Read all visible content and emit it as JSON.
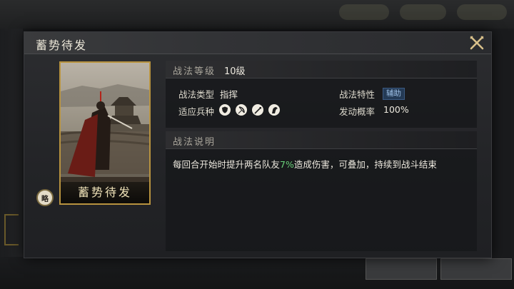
{
  "dialog": {
    "title": "蓄势待发"
  },
  "card": {
    "name": "蓄势待发",
    "badge": "略"
  },
  "skill": {
    "level_label": "战法等级",
    "level_value": "10级",
    "type_label": "战法类型",
    "type_value": "指挥",
    "trait_label": "战法特性",
    "trait_value": "辅助",
    "units_label": "适应兵种",
    "units": [
      "shield-icon",
      "bow-icon",
      "spear-icon",
      "horse-icon"
    ],
    "rate_label": "发动概率",
    "rate_value": "100%"
  },
  "description": {
    "label": "战法说明",
    "text_before": "每回合开始时提升两名队友",
    "highlight": "7%",
    "text_after": "造成伤害，可叠加，持续到战斗结束"
  },
  "colors": {
    "accent_gold": "#b8933f",
    "highlight_green": "#6ad17a",
    "tag_blue": "#243a55"
  }
}
